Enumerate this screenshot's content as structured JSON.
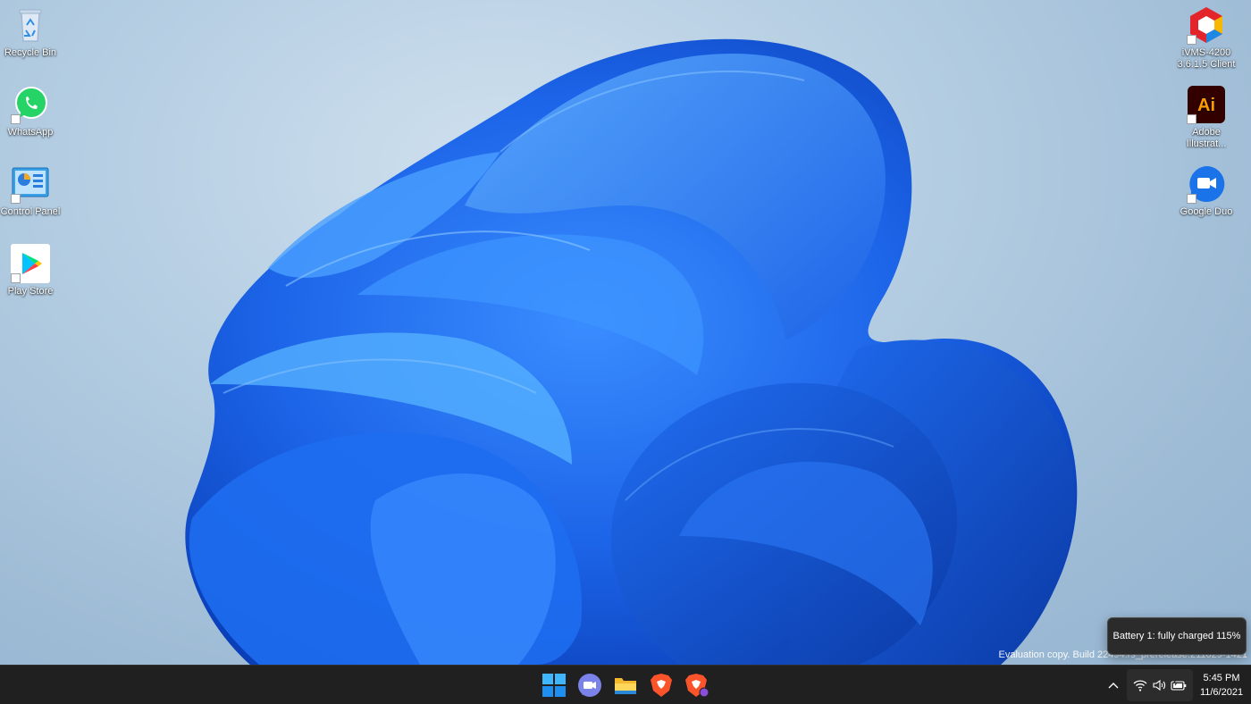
{
  "desktop": {
    "icons_left": [
      {
        "label": "Recycle Bin",
        "icon": "recycle-bin-icon"
      },
      {
        "label": "WhatsApp",
        "icon": "whatsapp-icon"
      },
      {
        "label": "Control Panel",
        "icon": "control-panel-icon"
      },
      {
        "label": "Play Store",
        "icon": "play-store-icon"
      }
    ],
    "icons_right": [
      {
        "label_line1": "iVMS-4200",
        "label_line2": "3.6.1.5 Client",
        "icon": "ivms-4200-icon"
      },
      {
        "label_line1": "Adobe",
        "label_line2": "Illustrat...",
        "icon": "adobe-illustrator-icon",
        "glyph_text": "Ai"
      },
      {
        "label_line1": "Google Duo",
        "label_line2": "",
        "icon": "google-duo-icon"
      }
    ],
    "watermark": "Evaluation copy. Build 22494.rs_prerelease.211029-1421"
  },
  "tooltip": {
    "text": "Battery 1: fully charged 115%"
  },
  "taskbar": {
    "pinned": [
      {
        "name": "start",
        "icon": "windows-start-icon"
      },
      {
        "name": "chat",
        "icon": "teams-chat-icon"
      },
      {
        "name": "file-explorer",
        "icon": "file-explorer-icon"
      },
      {
        "name": "brave-browser",
        "icon": "brave-icon"
      },
      {
        "name": "brave-browser-2",
        "icon": "brave-icon"
      }
    ],
    "tray": {
      "chevron_icon": "chevron-up-icon",
      "wifi_icon": "wifi-icon",
      "volume_icon": "speaker-icon",
      "battery_icon": "battery-charging-icon"
    },
    "clock": {
      "time": "5:45 PM",
      "date": "11/6/2021"
    }
  },
  "colors": {
    "taskbar_bg": "#202020",
    "wallpaper_blue": "#1a5fe0",
    "whatsapp_green": "#25d366",
    "illustrator_orange": "#ff9a00",
    "duo_blue": "#1a73e8",
    "brave_orange": "#fb542b"
  }
}
